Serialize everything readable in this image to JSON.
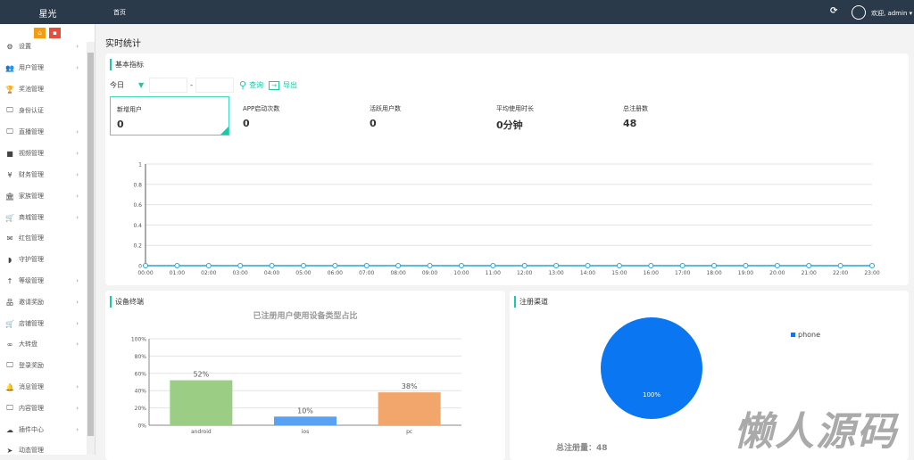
{
  "topbar": {
    "brand": "星光",
    "home": "首页",
    "user": "欢迎, admin ▾",
    "refresh_icon": "refresh-icon",
    "avatar_icon": "share-circle-icon"
  },
  "sidebar": {
    "items": [
      {
        "label": "设置",
        "icon": "⚙",
        "arrow": true
      },
      {
        "label": "用户管理",
        "icon": "👥",
        "arrow": true
      },
      {
        "label": "奖池管理",
        "icon": "🏆",
        "arrow": false
      },
      {
        "label": "身份认证",
        "icon": "🖵",
        "arrow": false
      },
      {
        "label": "直播管理",
        "icon": "🖵",
        "arrow": true
      },
      {
        "label": "视频管理",
        "icon": "■",
        "arrow": true
      },
      {
        "label": "财务管理",
        "icon": "¥",
        "arrow": true
      },
      {
        "label": "家族管理",
        "icon": "🏛",
        "arrow": true
      },
      {
        "label": "商城管理",
        "icon": "🛒",
        "arrow": true
      },
      {
        "label": "红包管理",
        "icon": "✉",
        "arrow": false
      },
      {
        "label": "守护管理",
        "icon": "◗",
        "arrow": false
      },
      {
        "label": "等级管理",
        "icon": "↑",
        "arrow": true
      },
      {
        "label": "邀请奖励",
        "icon": "品",
        "arrow": true
      },
      {
        "label": "店铺管理",
        "icon": "🛒",
        "arrow": true
      },
      {
        "label": "大转盘",
        "icon": "∞",
        "arrow": true
      },
      {
        "label": "登录奖励",
        "icon": "🖵",
        "arrow": false
      },
      {
        "label": "消息管理",
        "icon": "🔔",
        "arrow": true
      },
      {
        "label": "内容管理",
        "icon": "🖵",
        "arrow": true
      },
      {
        "label": "插件中心",
        "icon": "☁",
        "arrow": true
      },
      {
        "label": "动态管理",
        "icon": "➤",
        "arrow": false
      }
    ]
  },
  "page_title": "实时统计",
  "basic": {
    "title": "基本指标",
    "range": "今日",
    "separator": "-",
    "query": "查询",
    "export": "导出",
    "stats": [
      {
        "label": "新增用户",
        "value": "0"
      },
      {
        "label": "APP启动次数",
        "value": "0"
      },
      {
        "label": "活跃用户数",
        "value": "0"
      },
      {
        "label": "平均使用时长",
        "value": "0分钟"
      },
      {
        "label": "总注册数",
        "value": "48"
      }
    ]
  },
  "device": {
    "title": "设备终端"
  },
  "channel": {
    "title": "注册渠道",
    "total_label": "总注册量：",
    "total": "48"
  },
  "watermark": "懒人源码",
  "chart_data": [
    {
      "type": "line",
      "x": [
        "00:00",
        "01:00",
        "02:00",
        "03:00",
        "04:00",
        "05:00",
        "06:00",
        "07:00",
        "08:00",
        "09:00",
        "10:00",
        "11:00",
        "12:00",
        "13:00",
        "14:00",
        "15:00",
        "16:00",
        "17:00",
        "18:00",
        "19:00",
        "20:00",
        "21:00",
        "22:00",
        "23:00"
      ],
      "values": [
        0,
        0,
        0,
        0,
        0,
        0,
        0,
        0,
        0,
        0,
        0,
        0,
        0,
        0,
        0,
        0,
        0,
        0,
        0,
        0,
        0,
        0,
        0,
        0
      ],
      "ylim": [
        0,
        1
      ],
      "yticks": [
        "0",
        "0.2",
        "0.4",
        "0.6",
        "0.8",
        "1"
      ],
      "color": "#29a3d8",
      "grid": true
    },
    {
      "type": "bar",
      "title": "已注册用户使用设备类型占比",
      "categories": [
        "android",
        "ios",
        "pc"
      ],
      "values": [
        52,
        10,
        38
      ],
      "labels": [
        "52%",
        "10%",
        "38%"
      ],
      "colors": [
        "#9ccd84",
        "#58a1f3",
        "#f2a66b"
      ],
      "ylim": [
        0,
        100
      ],
      "yticks": [
        "0%",
        "20%",
        "40%",
        "60%",
        "80%",
        "100%"
      ],
      "grid": true
    },
    {
      "type": "pie",
      "slices": [
        {
          "name": "phone",
          "value": 100,
          "label": "100%"
        }
      ],
      "colors": [
        "#0b76f2"
      ],
      "legend": "top-right"
    }
  ]
}
